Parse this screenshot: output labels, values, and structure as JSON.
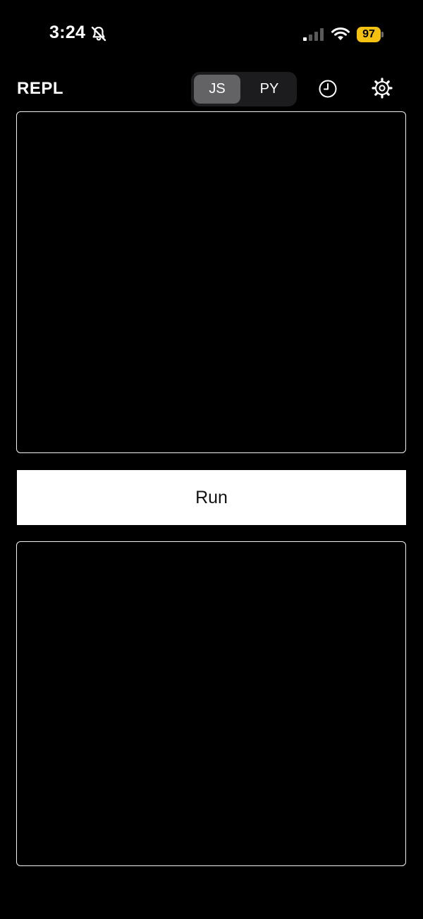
{
  "status_bar": {
    "time": "3:24",
    "battery_level": "97",
    "battery_color": "#f5c211",
    "icons": [
      "bell-muted-icon",
      "signal-icon",
      "wifi-icon",
      "battery-icon"
    ]
  },
  "header": {
    "title": "REPL",
    "language_toggle": {
      "options": [
        "JS",
        "PY"
      ],
      "selected": "JS"
    },
    "icons": [
      "history-icon",
      "settings-icon"
    ]
  },
  "editor": {
    "content": ""
  },
  "run_button": {
    "label": "Run"
  },
  "output": {
    "content": ""
  },
  "colors": {
    "background": "#000000",
    "panel_border": "#f2f2f2",
    "segment_selected": "#636366",
    "segment_track": "#1c1c1e",
    "run_button_bg": "#ffffff"
  }
}
